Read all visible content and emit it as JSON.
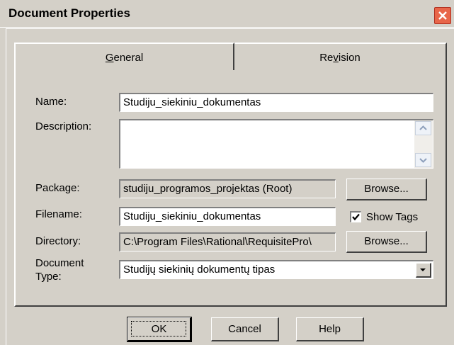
{
  "window": {
    "title": "Document Properties"
  },
  "tabs": [
    {
      "label": "General",
      "mnemonic": "G",
      "rest": "eneral"
    },
    {
      "label": "Revision",
      "pre": "Re",
      "mnemonic": "v",
      "rest": "ision"
    }
  ],
  "form": {
    "name_label": "Name:",
    "name_value": "Studiju_siekiniu_dokumentas",
    "description_label": "Description:",
    "description_value": "",
    "package_label": "Package:",
    "package_value": "studiju_programos_projektas (Root)",
    "filename_label": "Filename:",
    "filename_value": "Studiju_siekiniu_dokumentas",
    "show_tags_label": "Show Tags",
    "show_tags_checked": true,
    "directory_label": "Directory:",
    "directory_value": "C:\\Program Files\\Rational\\RequisitePro\\",
    "doctype_label_line1": "Document",
    "doctype_label_line2": "Type:",
    "doctype_value": "Studijų siekinių dokumentų tipas",
    "browse_label": "Browse..."
  },
  "buttons": {
    "ok": "OK",
    "cancel": "Cancel",
    "help": "Help"
  },
  "icons": [
    "close-icon",
    "scroll-up-icon",
    "scroll-down-icon",
    "checkmark-icon",
    "dropdown-arrow-icon"
  ]
}
